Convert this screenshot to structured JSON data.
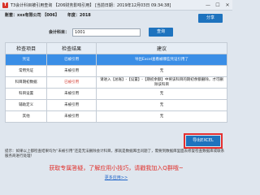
{
  "window": {
    "title": "T3会计科目被引用查询 【206财务影响引用】 [当前日期：2019年12月03日 09:34:38]",
    "minimize": "—",
    "maximize": "☐",
    "close": "✕"
  },
  "account": {
    "user_label": "账套：xxx有限公司 【006】",
    "year_label": "年度：2018"
  },
  "share_label": "分享",
  "search": {
    "label": "会计科目：",
    "value": "1001",
    "button": "查询"
  },
  "table": {
    "headers": [
      "检查项目",
      "检查结果",
      "建议"
    ],
    "rows": [
      {
        "item": "凭证",
        "result": "已被引用",
        "result_red": true,
        "advice": "导出Excel查看被哪些凭证引用了",
        "highlight": true
      },
      {
        "item": "常用凭证",
        "result": "未被引用",
        "result_red": false,
        "advice": "无",
        "highlight": false
      },
      {
        "item": "科目期初数据",
        "result": "已被引用",
        "result_red": true,
        "advice": "请进入【总账】-【设置】-【期初余额】中将该科目的期初余额删除，才可删除该科目",
        "highlight": false
      },
      {
        "item": "科目设置",
        "result": "未被引用",
        "result_red": false,
        "advice": "无",
        "highlight": false
      },
      {
        "item": "辅助定义",
        "result": "未被引用",
        "result_red": false,
        "advice": "无",
        "highlight": false
      },
      {
        "item": "其他",
        "result": "未被引用",
        "result_red": false,
        "advice": "无",
        "highlight": false
      }
    ]
  },
  "export_button": "导出EXCEL",
  "note": "提示：如果以上都检查结果均为“未被引用”还是无法删除会计科目，那就是数据库出问题了，需要到数据库里面去修复检查数据库或联系服务商进行处理！",
  "promo": "获取专属答疑，了解应用小技巧，请戳我加入Q群哦~",
  "more_link": "更多应用>>",
  "colors": {
    "accent": "#1e73be",
    "highlight_row": "#3a8ee6",
    "warning_red": "#d23a2f",
    "export_outline": "#e53030"
  }
}
